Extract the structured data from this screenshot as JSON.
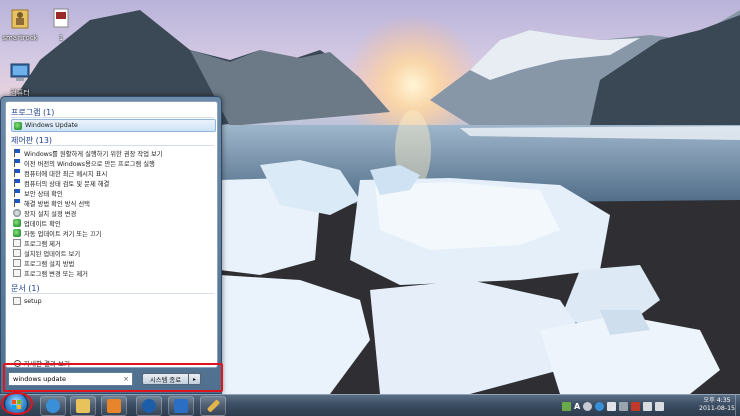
{
  "desktop": {
    "icons": [
      {
        "label": "smartrock",
        "icon": "user-folder-icon"
      },
      {
        "label": "1",
        "icon": "image-file-icon"
      },
      {
        "label": "컴퓨터",
        "icon": "computer-icon"
      }
    ]
  },
  "start_menu": {
    "groups": [
      {
        "title": "프로그램 (1)",
        "items": [
          {
            "label": "Windows Update",
            "icon": "windows-update-icon",
            "selected": true
          }
        ]
      },
      {
        "title": "제어판 (13)",
        "items": [
          {
            "label": "Windows를 원활하게 실행하기 위한 권장 작업 보기",
            "icon": "flag-icon"
          },
          {
            "label": "이전 버전의 Windows용으로 만든 프로그램 실행",
            "icon": "flag-icon"
          },
          {
            "label": "컴퓨터에 대한 최근 메시지 표시",
            "icon": "flag-icon"
          },
          {
            "label": "컴퓨터의 상태 검토 및 문제 해결",
            "icon": "flag-icon"
          },
          {
            "label": "보안 상태 확인",
            "icon": "flag-icon"
          },
          {
            "label": "해결 방법 확인 방식 선택",
            "icon": "flag-icon"
          },
          {
            "label": "장치 설치 설정 변경",
            "icon": "gear-icon"
          },
          {
            "label": "업데이트 확인",
            "icon": "windows-update-icon"
          },
          {
            "label": "자동 업데이트 켜기 또는 끄기",
            "icon": "windows-update-icon"
          },
          {
            "label": "프로그램 제거",
            "icon": "programs-icon"
          },
          {
            "label": "설치된 업데이트 보기",
            "icon": "programs-icon"
          },
          {
            "label": "프로그램 설치 방법",
            "icon": "programs-icon"
          },
          {
            "label": "프로그램 변경 또는 제거",
            "icon": "programs-icon"
          }
        ]
      },
      {
        "title": "문서 (1)",
        "items": [
          {
            "label": "setup",
            "icon": "document-icon"
          }
        ]
      }
    ],
    "more_results_label": "자세한 결과 보기",
    "search_value": "windows update",
    "search_clear": "×",
    "shutdown_label": "시스템 종료",
    "shutdown_arrow": "▸"
  },
  "taskbar": {
    "pinned": [
      {
        "name": "internet-explorer-icon",
        "color": "#3a8fd9"
      },
      {
        "name": "file-explorer-icon",
        "color": "#e8c25a"
      },
      {
        "name": "media-player-icon",
        "color": "#e8842a"
      },
      {
        "name": "hp-icon",
        "color": "#1d5ea8"
      },
      {
        "name": "checkmark-app-icon",
        "color": "#2a6fc4"
      },
      {
        "name": "pencil-app-icon",
        "color": "#e3b44a"
      }
    ],
    "tray_lang": "A",
    "clock_time": "오후 4:35",
    "clock_date": "2011-08-15"
  },
  "colors": {
    "highlight": "#e0141e",
    "group_title": "#1e3f8a"
  }
}
